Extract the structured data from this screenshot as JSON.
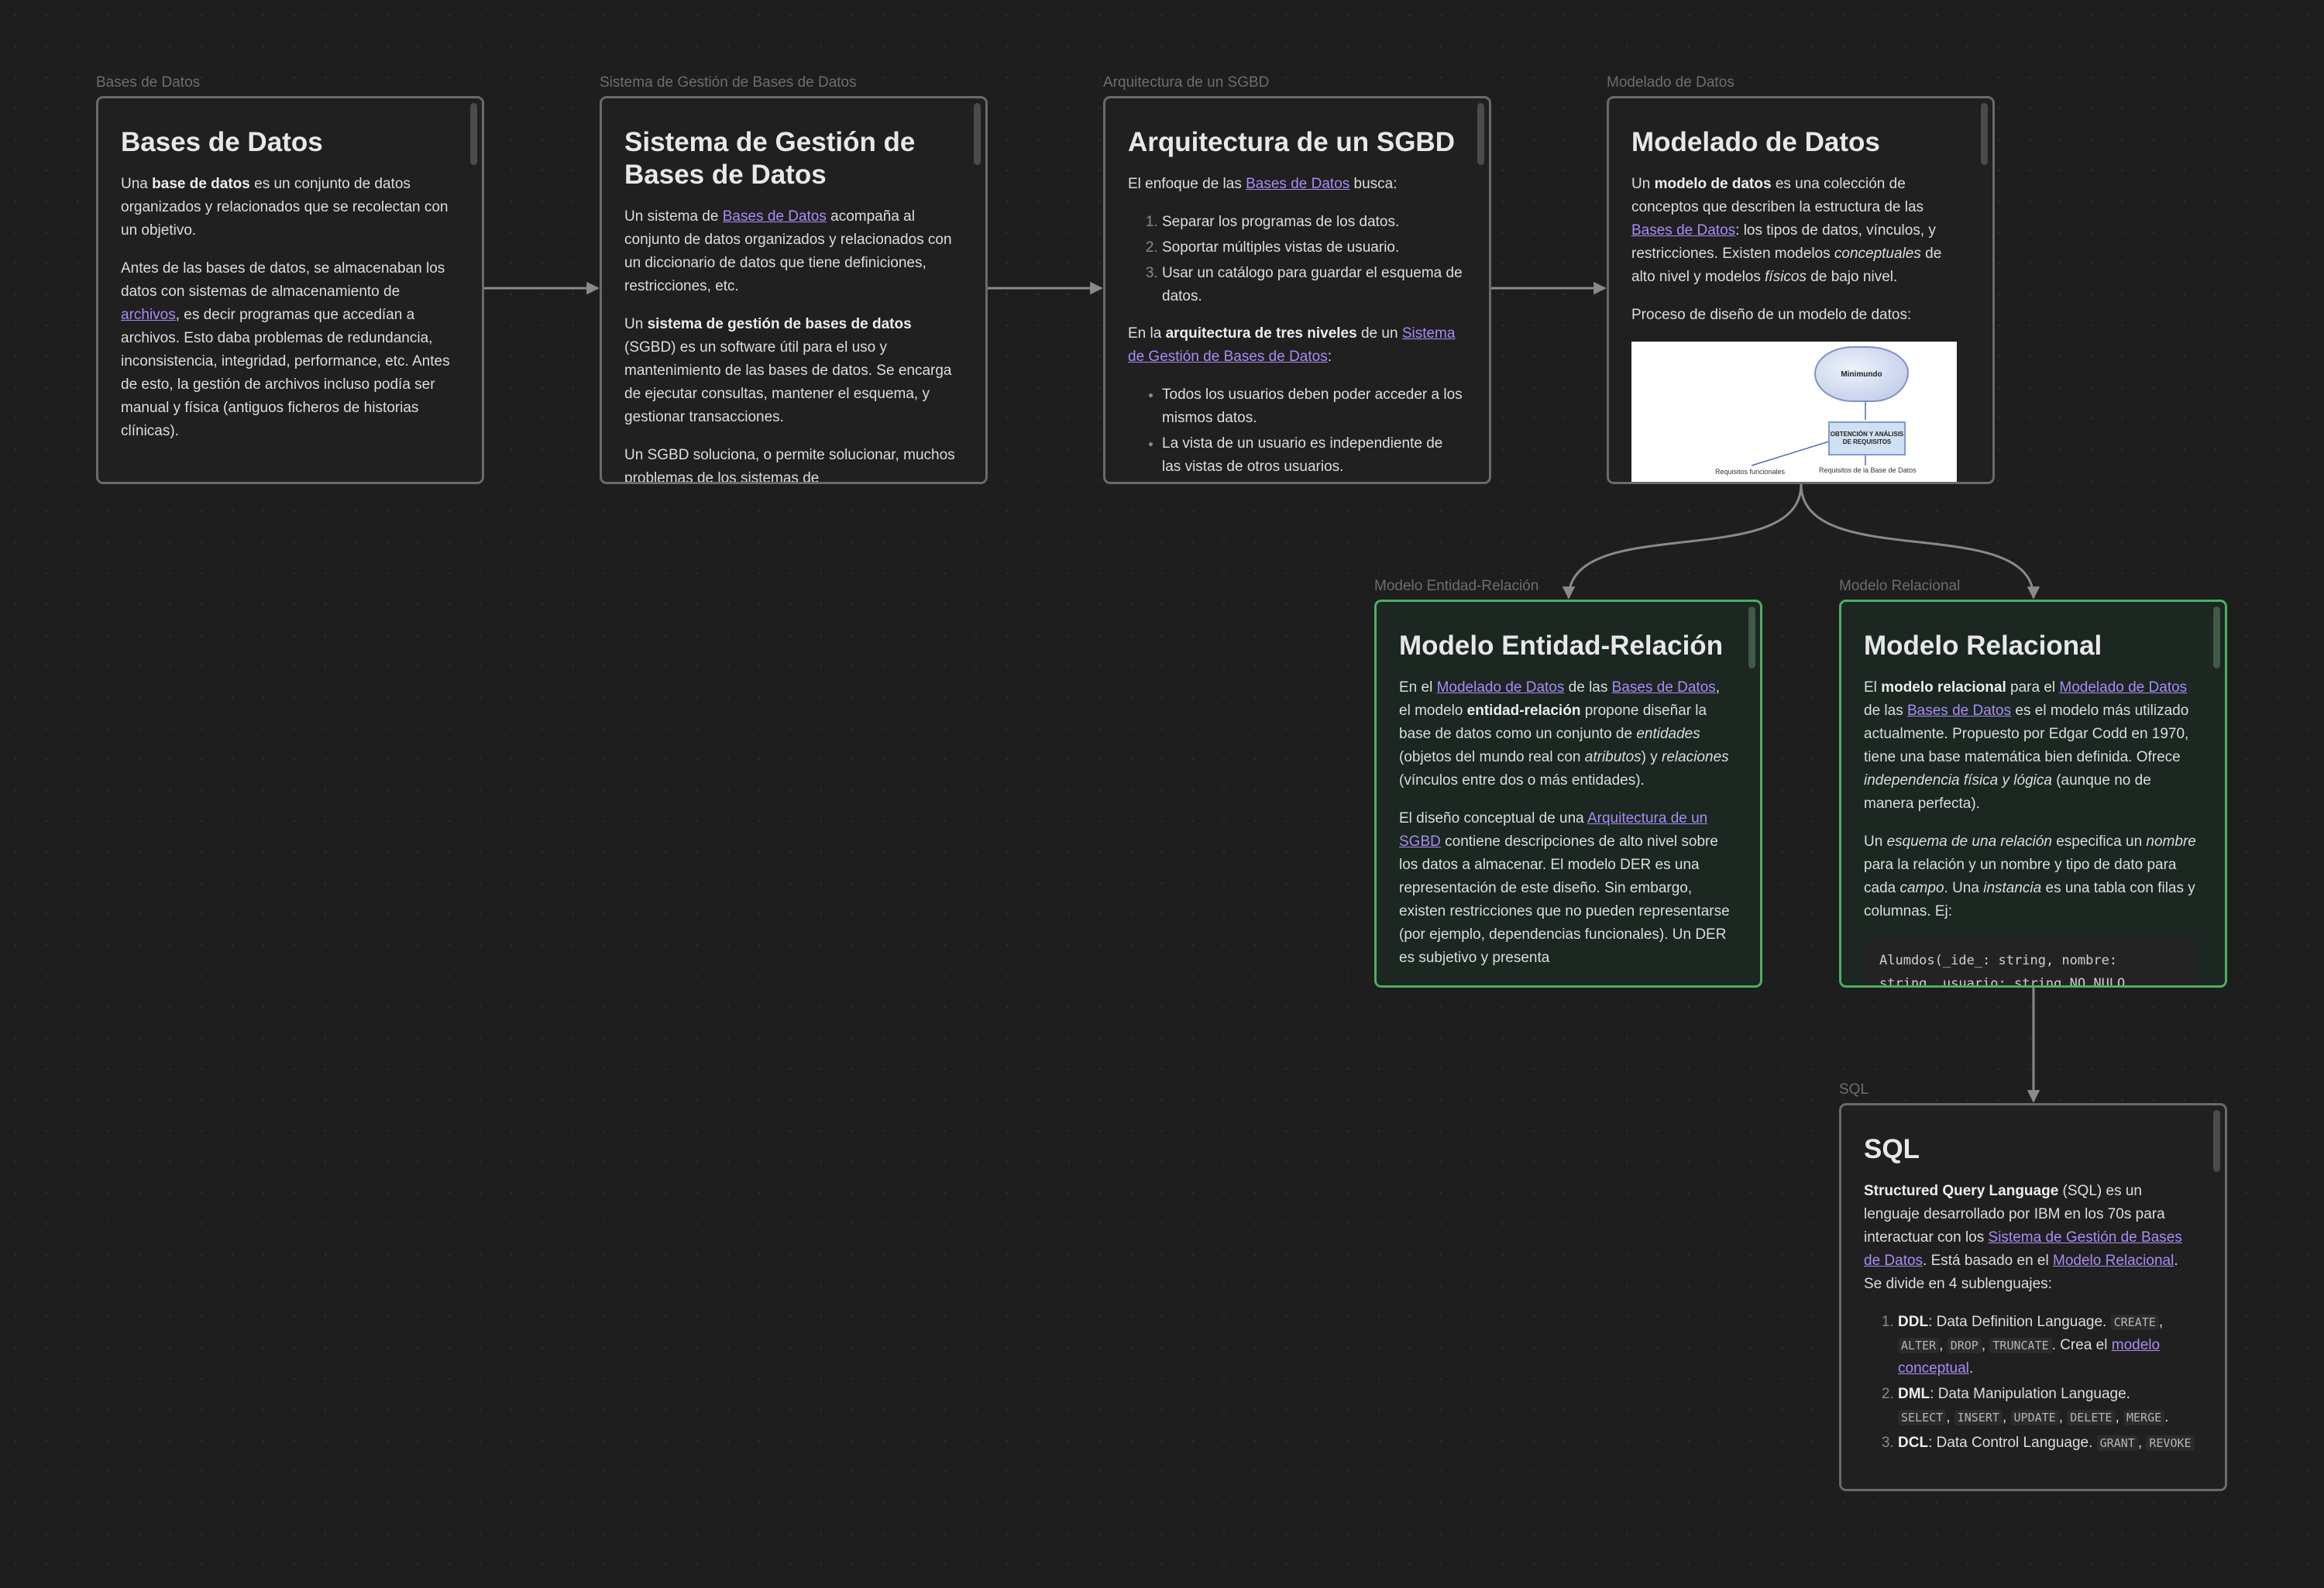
{
  "colors": {
    "background": "#1e1e1e",
    "card_border": "#6a6a6a",
    "green_border": "#4caf64",
    "link": "#a98bf5",
    "edge": "#8a8a8a"
  },
  "nodes": {
    "bd": {
      "label": "Bases de Datos",
      "title": "Bases de Datos",
      "p1_a": "Una ",
      "p1_b": "base de datos",
      "p1_c": " es un conjunto de datos organizados y relacionados que se recolectan con un objetivo.",
      "p2_a": "Antes de las bases de datos, se almacenaban los datos con sistemas de almacenamiento de ",
      "p2_link": "archivos",
      "p2_c": ", es decir programas que accedían a archivos. Esto daba problemas de redundancia, inconsistencia, integridad, performance, etc. Antes de esto, la gestión de archivos incluso podía ser manual y física (antiguos ficheros de historias clínicas)."
    },
    "sgbd": {
      "label": "Sistema de Gestión de Bases de Datos",
      "title": "Sistema de Gestión de Bases de Datos",
      "p1_a": "Un sistema de ",
      "p1_link": "Bases de Datos",
      "p1_c": " acompaña al conjunto de datos organizados y relacionados con un diccionario de datos que tiene definiciones, restricciones, etc.",
      "p2_a": "Un ",
      "p2_b": "sistema de gestión de bases de datos",
      "p2_c": " (SGBD) es un software útil para el uso y mantenimiento de las bases de datos. Se encarga de ejecutar consultas, mantener el esquema, y gestionar transacciones.",
      "p3": "Un SGBD soluciona, o permite solucionar, muchos problemas de los sistemas de"
    },
    "arq": {
      "label": "Arquitectura de un SGBD",
      "title": "Arquitectura de un SGBD",
      "p1_a": "El enfoque de las ",
      "p1_link": "Bases de Datos",
      "p1_c": " busca:",
      "ol": [
        "Separar los programas de los datos.",
        "Soportar múltiples vistas de usuario.",
        "Usar un catálogo para guardar el esquema de datos."
      ],
      "p2_a": "En la ",
      "p2_b": "arquitectura de tres niveles",
      "p2_c": " de un ",
      "p2_link": "Sistema de Gestión de Bases de Datos",
      "p2_d": ":",
      "ul": [
        "Todos los usuarios deben poder acceder a los mismos datos.",
        "La vista de un usuario es independiente de las vistas de otros usuarios."
      ]
    },
    "mod": {
      "label": "Modelado de Datos",
      "title": "Modelado de Datos",
      "p1_a": "Un ",
      "p1_b": "modelo de datos",
      "p1_c": " es una colección de conceptos que describen la estructura de las ",
      "p1_link": "Bases de Datos",
      "p1_d": ": los tipos de datos, vínculos, y restricciones. Existen modelos ",
      "p1_e": "conceptuales",
      "p1_f": " de alto nivel y modelos ",
      "p1_g": "físicos",
      "p1_h": " de bajo nivel.",
      "p2": "Proceso de diseño de un modelo de datos:",
      "diagram": {
        "cloud": "Minimundo",
        "box": "OBTENCIÓN Y ANÁLISIS DE REQUISITOS",
        "left_label": "Requisitos funcionales",
        "right_label": "Requisitos de la Base de Datos"
      }
    },
    "er": {
      "label": "Modelo Entidad-Relación",
      "title": "Modelo Entidad-Relación",
      "p1_a": "En el ",
      "p1_link1": "Modelado de Datos",
      "p1_b": " de las ",
      "p1_link2": "Bases de Datos",
      "p1_c": ", el modelo ",
      "p1_d": "entidad-relación",
      "p1_e": " propone diseñar la base de datos como un conjunto de ",
      "p1_f": "entidades",
      "p1_g": " (objetos del mundo real con ",
      "p1_h": "atributos",
      "p1_i": ") y ",
      "p1_j": "relaciones",
      "p1_k": " (vínculos entre dos o más entidades).",
      "p2_a": "El diseño conceptual de una ",
      "p2_link": "Arquitectura de un SGBD",
      "p2_c": " contiene descripciones de alto nivel sobre los datos a almacenar. El modelo DER es una representación de este diseño. Sin embargo, existen restricciones que no pueden representarse (por ejemplo, dependencias funcionales). Un DER es subjetivo y presenta"
    },
    "rel": {
      "label": "Modelo Relacional",
      "title": "Modelo Relacional",
      "p1_a": "El ",
      "p1_b": "modelo relacional",
      "p1_c": " para el ",
      "p1_link1": "Modelado de Datos",
      "p1_d": " de las ",
      "p1_link2": "Bases de Datos",
      "p1_e": " es el modelo más utilizado actualmente. Propuesto por Edgar Codd en 1970, tiene una base matemática bien definida. Ofrece ",
      "p1_f": "independencia física y lógica",
      "p1_g": " (aunque no de manera perfecta).",
      "p2_a": "Un ",
      "p2_b": "esquema de una relación",
      "p2_c": " especifica un ",
      "p2_d": "nombre",
      "p2_e": " para la relación y un nombre y tipo de dato para cada ",
      "p2_f": "campo",
      "p2_g": ". Una ",
      "p2_h": "instancia",
      "p2_i": " es una tabla con filas y columnas. Ej:",
      "code": "Alumdos(_ide_: string, nombre:\nstring, usuario: string NO NULO,"
    },
    "sql": {
      "label": "SQL",
      "title": "SQL",
      "p1_a": "Structured Query Language",
      "p1_b": " (SQL) es un lenguaje desarrollado por IBM en los 70s para interactuar con los ",
      "p1_link1": "Sistema de Gestión de Bases de Datos",
      "p1_c": ". Está basado en el ",
      "p1_link2": "Modelo Relacional",
      "p1_d": ". Se divide en 4 sublenguajes:",
      "li1_b": "DDL",
      "li1_t": ": Data Definition Language. ",
      "li1_codes": [
        "CREATE",
        "ALTER",
        "DROP",
        "TRUNCATE"
      ],
      "li1_t2": ". Crea el ",
      "li1_link": "modelo conceptual",
      "li1_t3": ".",
      "li2_b": "DML",
      "li2_t": ": Data Manipulation Language.",
      "li2_codes": [
        "SELECT",
        "INSERT",
        "UPDATE",
        "DELETE",
        "MERGE"
      ],
      "li2_t2": ".",
      "li3_b": "DCL",
      "li3_t": ": Data Control Language. ",
      "li3_codes": [
        "GRANT",
        "REVOKE"
      ]
    }
  }
}
